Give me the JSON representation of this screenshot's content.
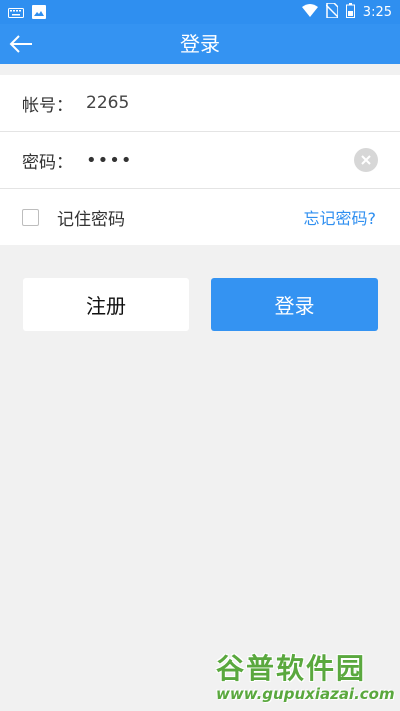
{
  "status_bar": {
    "time": "3:25",
    "left_icons": [
      "keyboard-icon",
      "image-icon"
    ],
    "right_icons": [
      "wifi-icon",
      "no-sim-icon",
      "battery-icon"
    ]
  },
  "app_bar": {
    "title": "登录",
    "back_icon": "arrow-left-icon",
    "color": "#3493f2"
  },
  "form": {
    "account": {
      "label": "帐号：",
      "value": "2265"
    },
    "password": {
      "label": "密码：",
      "value": "••••",
      "clear_icon": "clear-circle-icon"
    },
    "remember": {
      "label": "记住密码",
      "checked": false
    },
    "forgot_link": "忘记密码?"
  },
  "buttons": {
    "register": "注册",
    "login": "登录"
  },
  "watermark": {
    "title": "谷普软件园",
    "url": "www.gupuxiazai.com"
  }
}
